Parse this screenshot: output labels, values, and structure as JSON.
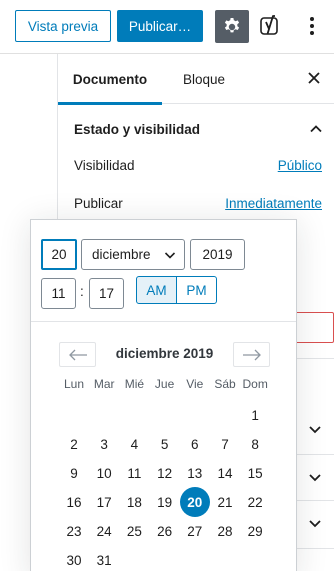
{
  "toolbar": {
    "preview_label": "Vista previa",
    "publish_label": "Publicar…"
  },
  "sidebar": {
    "tabs": [
      {
        "label": "Documento"
      },
      {
        "label": "Bloque"
      }
    ],
    "panel": {
      "title": "Estado y visibilidad",
      "visibility_label": "Visibilidad",
      "visibility_value": "Público",
      "publish_label": "Publicar",
      "publish_value": "Inmediatamente"
    }
  },
  "date_picker": {
    "day": "20",
    "month": "diciembre",
    "year": "2019",
    "hour": "11",
    "minute": "17",
    "am_label": "AM",
    "pm_label": "PM",
    "selected_meridiem": "AM",
    "calendar_title": "diciembre 2019",
    "weekdays": [
      "Lun",
      "Mar",
      "Mié",
      "Jue",
      "Vie",
      "Sáb",
      "Dom"
    ],
    "selected_day": 20
  },
  "colors": {
    "accent": "#007cba",
    "settings_active": "#555d66",
    "hidden_error_border": "#d94f4f"
  }
}
